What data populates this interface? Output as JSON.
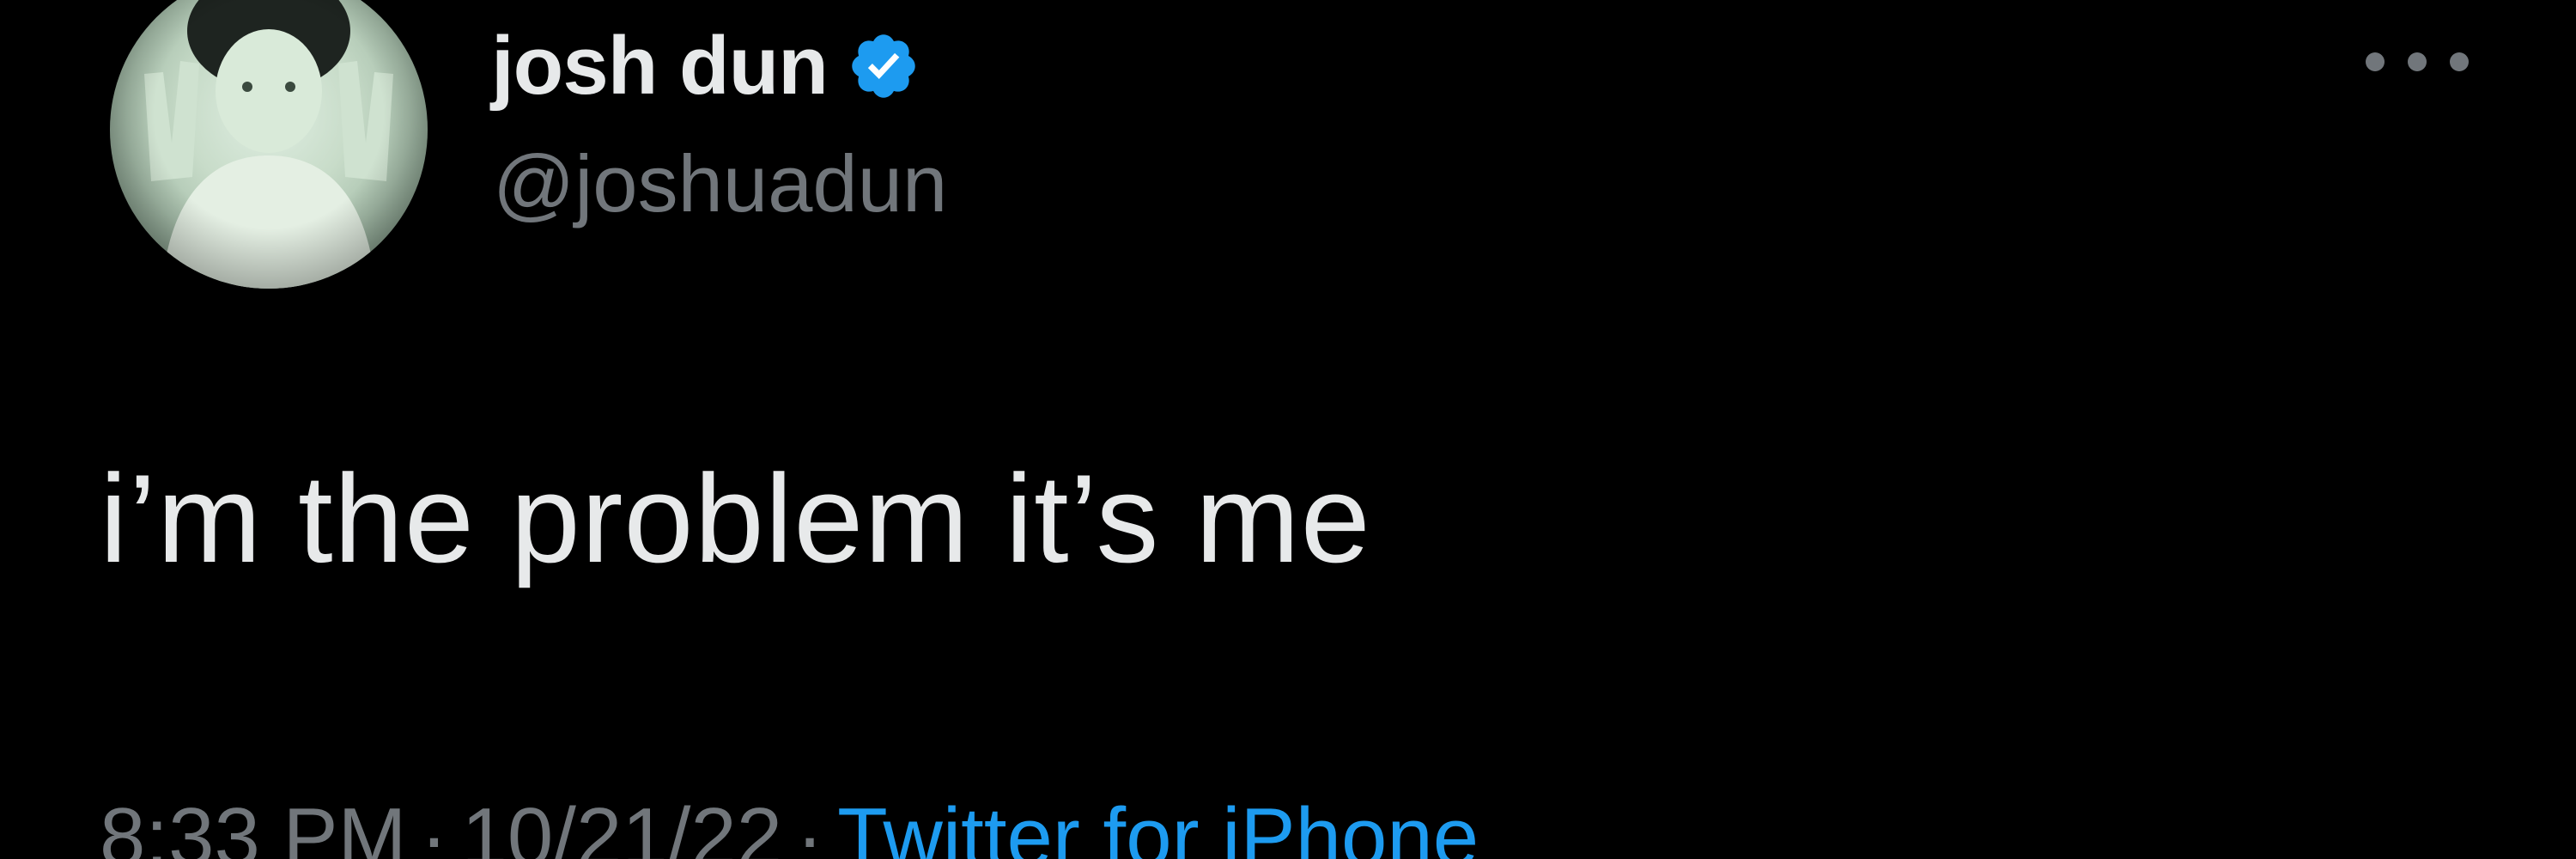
{
  "user": {
    "display_name": "josh dun",
    "handle": "@joshuadun",
    "verified": true,
    "avatar_icon": "profile-photo"
  },
  "tweet": {
    "text": "i’m the problem it’s me",
    "time": "8:33 PM",
    "separator": "·",
    "date": "10/21/22",
    "source": "Twitter for iPhone"
  },
  "icons": {
    "verified": "verified-badge-icon",
    "more": "more-options-icon"
  },
  "colors": {
    "background": "#000000",
    "primary_text": "#e7e9ea",
    "secondary_text": "#71767b",
    "accent": "#1d9bf0"
  }
}
